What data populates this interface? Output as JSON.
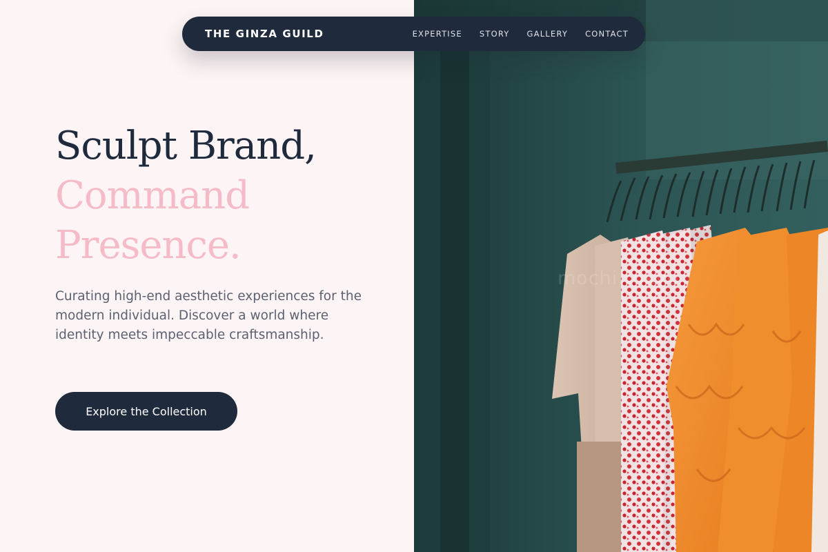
{
  "brand": {
    "name": "THE GINZA GUILD"
  },
  "nav": {
    "links": [
      {
        "label": "EXPERTISE"
      },
      {
        "label": "STORY"
      },
      {
        "label": "GALLERY"
      },
      {
        "label": "CONTACT"
      }
    ]
  },
  "hero": {
    "title_line1": "Sculpt Brand,",
    "title_line2": "Command",
    "title_line3": "Presence.",
    "description": "Curating high-end aesthetic experiences for the modern individual. Discover a world where identity meets impeccable craftsmanship.",
    "cta_label": "Explore the Collection"
  },
  "image": {
    "subject": "clothing rack with hanging garments against teal wall",
    "watermark": "mochi.tokyo"
  },
  "colors": {
    "navy": "#1f2a3c",
    "pink_accent": "#f5bcc8",
    "background": "#fdf4f5",
    "body_text": "#5b6171",
    "photo_teal": "#234846"
  }
}
